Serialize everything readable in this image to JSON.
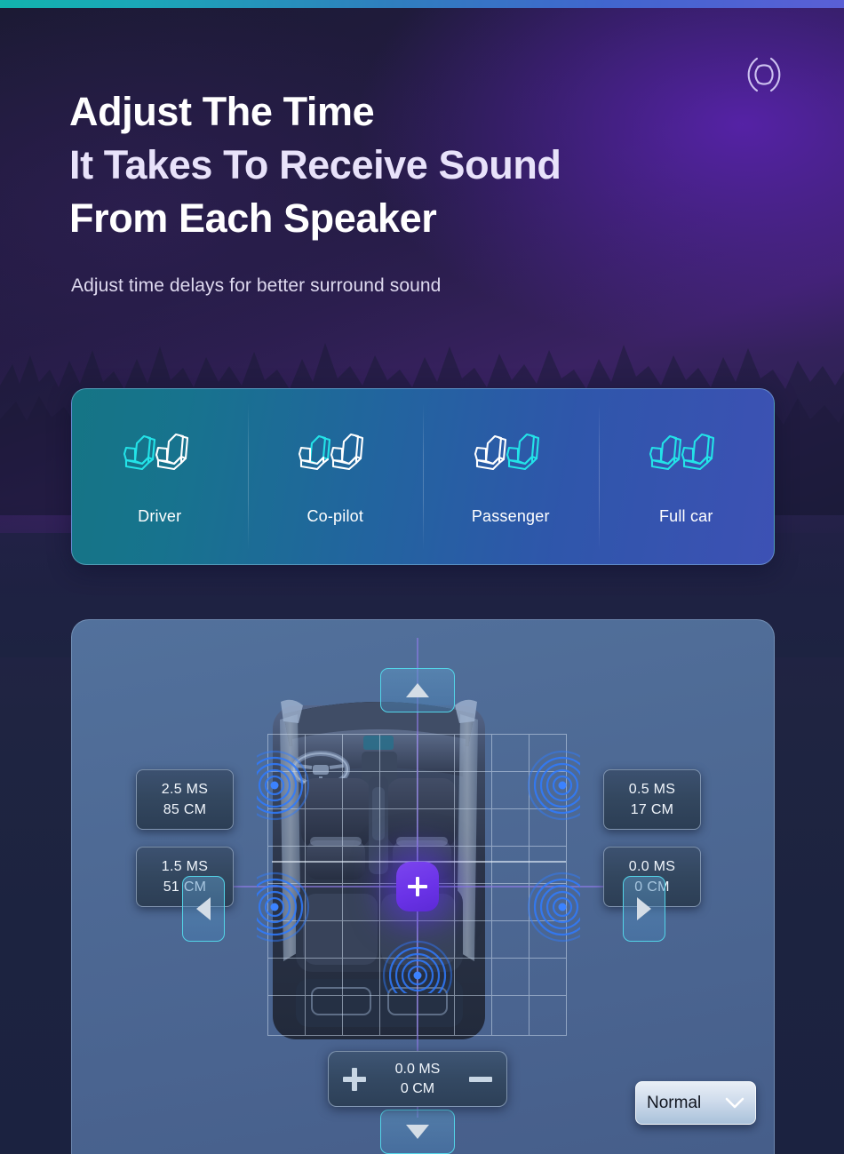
{
  "theme": {
    "accent_teal": "#12b3ad",
    "accent_blue": "#3d51b4",
    "accent_cyan": "#53d4e8",
    "marker_purple": "#6b33e8",
    "panel_blue": "#4e6a95",
    "bg_navy": "#1c2340"
  },
  "header": {
    "title_lines": [
      "Adjust The Time",
      "It Takes To Receive Sound",
      "From Each Speaker"
    ],
    "subtitle": "Adjust time delays for better surround sound",
    "badge_icon": "sound-ripple-icon"
  },
  "seat_tabs": {
    "items": [
      {
        "label": "Driver",
        "icon": "seat-pair-icon",
        "highlight": "left",
        "selected": false
      },
      {
        "label": "Co-pilot",
        "icon": "seat-pair-icon",
        "highlight": "front-left",
        "selected": false
      },
      {
        "label": "Passenger",
        "icon": "seat-pair-icon",
        "highlight": "right",
        "selected": false
      },
      {
        "label": "Full car",
        "icon": "seat-pair-icon",
        "highlight": "both",
        "selected": false
      }
    ]
  },
  "delay_panel": {
    "nudge_up": {
      "icon": "triangle-up-icon"
    },
    "nudge_down": {
      "icon": "triangle-down-icon"
    },
    "nudge_left": {
      "icon": "triangle-left-icon"
    },
    "nudge_right": {
      "icon": "triangle-right-icon"
    },
    "center_marker_icon": "plus-crosshair-icon",
    "value_boxes": [
      {
        "position": "front-left",
        "ms": "2.5 MS",
        "cm": "85 CM"
      },
      {
        "position": "rear-left",
        "ms": "1.5 MS",
        "cm": "51 CM"
      },
      {
        "position": "front-right",
        "ms": "0.5 MS",
        "cm": "17 CM"
      },
      {
        "position": "rear-right",
        "ms": "0.0 MS",
        "cm": "0 CM"
      }
    ],
    "stepper": {
      "increase_icon": "plus-icon",
      "decrease_icon": "minus-icon",
      "ms": "0.0 MS",
      "cm": "0 CM"
    },
    "mode_select": {
      "value": "Normal",
      "chevron_icon": "chevron-down-icon"
    },
    "speakers": [
      {
        "id": "front-left"
      },
      {
        "id": "front-right"
      },
      {
        "id": "rear-left"
      },
      {
        "id": "rear-right"
      },
      {
        "id": "subwoofer"
      }
    ]
  }
}
